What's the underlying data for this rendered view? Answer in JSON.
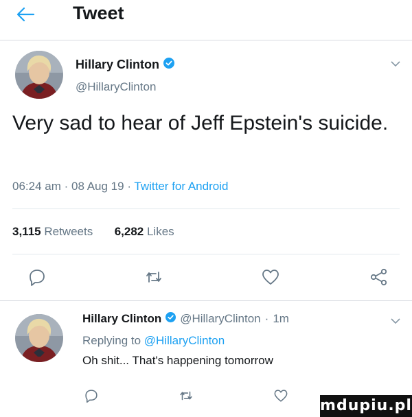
{
  "header": {
    "title": "Tweet",
    "back_icon": "arrow-left-icon"
  },
  "tweet": {
    "author_name": "Hillary Clinton",
    "handle": "@HillaryClinton",
    "verified": true,
    "text": "Very sad to hear of Jeff Epstein's suicide.",
    "time": "06:24 am",
    "date": "08 Aug 19",
    "client": "Twitter for Android",
    "retweets": "3,115",
    "retweets_label": "Retweets",
    "likes": "6,282",
    "likes_label": "Likes"
  },
  "actions": [
    "reply-icon",
    "retweet-icon",
    "like-icon",
    "share-icon"
  ],
  "reply": {
    "author_name": "Hillary Clinton",
    "handle": "@HillaryClinton",
    "age": "1m",
    "replying_prefix": "Replying to",
    "replying_to": "@HillaryClinton",
    "text": "Oh shit... That's happening tomorrow"
  },
  "watermark": "mdupiu.pl",
  "colors": {
    "accent": "#1da1f2",
    "secondary_text": "#657786",
    "primary_text": "#14171a",
    "divider": "#e1e8ed"
  }
}
